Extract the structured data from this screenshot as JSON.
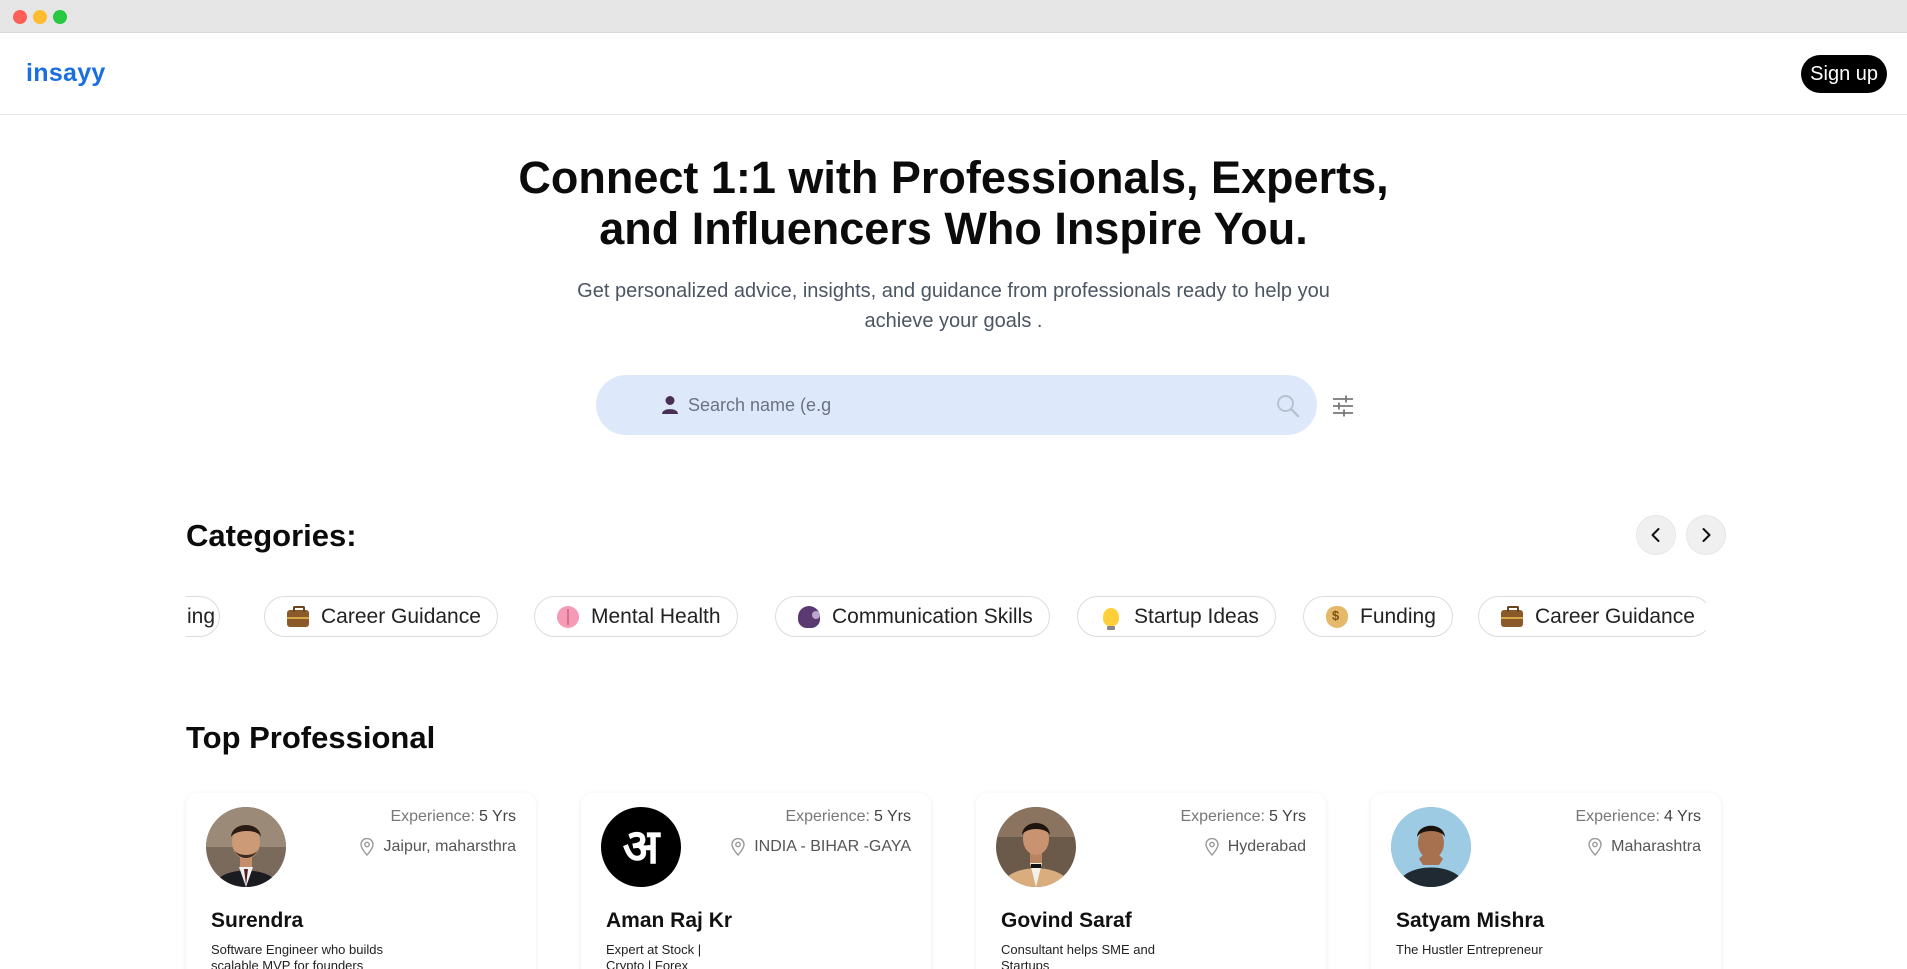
{
  "navbar": {
    "logo": "insayy",
    "signup_label": "Sign up"
  },
  "hero": {
    "title_line1": "Connect 1:1 with Professionals, Experts,",
    "title_line2": "and Influencers Who Inspire You.",
    "subtitle_line1": "Get personalized advice, insights, and guidance from professionals ready to help you",
    "subtitle_line2": "achieve your goals ."
  },
  "search": {
    "placeholder": "Search name (e.g",
    "value": "",
    "person_icon": "person-icon",
    "search_icon": "search-icon",
    "filter_icon": "sliders-icon"
  },
  "categories": {
    "title": "Categories:",
    "prev_icon": "chevron-left-icon",
    "next_icon": "chevron-right-icon",
    "partial_label": "ing",
    "items": [
      {
        "label": "Career Guidance",
        "icon": "briefcase-icon"
      },
      {
        "label": "Mental Health",
        "icon": "brain-icon"
      },
      {
        "label": "Communication Skills",
        "icon": "speaking-head-icon"
      },
      {
        "label": "Startup Ideas",
        "icon": "lightbulb-icon"
      },
      {
        "label": "Funding",
        "icon": "money-bag-icon"
      },
      {
        "label": "Career Guidance",
        "icon": "briefcase-icon"
      }
    ]
  },
  "top": {
    "title": "Top Professional",
    "experience_label": "Experience:",
    "cards": [
      {
        "name": "Surendra",
        "experience": "5 Yrs",
        "location": "Jaipur, maharsthra",
        "bio": "Software Engineer who builds scalable MVP for founders"
      },
      {
        "name": "Aman Raj Kr",
        "experience": "5 Yrs",
        "location": "INDIA - BIHAR -GAYA",
        "bio": "Expert at Stock | Crypto | Forex",
        "avatar_glyph": "अ"
      },
      {
        "name": "Govind Saraf",
        "experience": "5 Yrs",
        "location": "Hyderabad",
        "bio": "Consultant helps SME and Startups"
      },
      {
        "name": "Satyam Mishra",
        "experience": "4 Yrs",
        "location": "Maharashtra",
        "bio": "The Hustler Entrepreneur"
      }
    ]
  },
  "colors": {
    "brand": "#1a6fe0",
    "search_bg": "#dde9fb",
    "signup_bg": "#000000"
  }
}
